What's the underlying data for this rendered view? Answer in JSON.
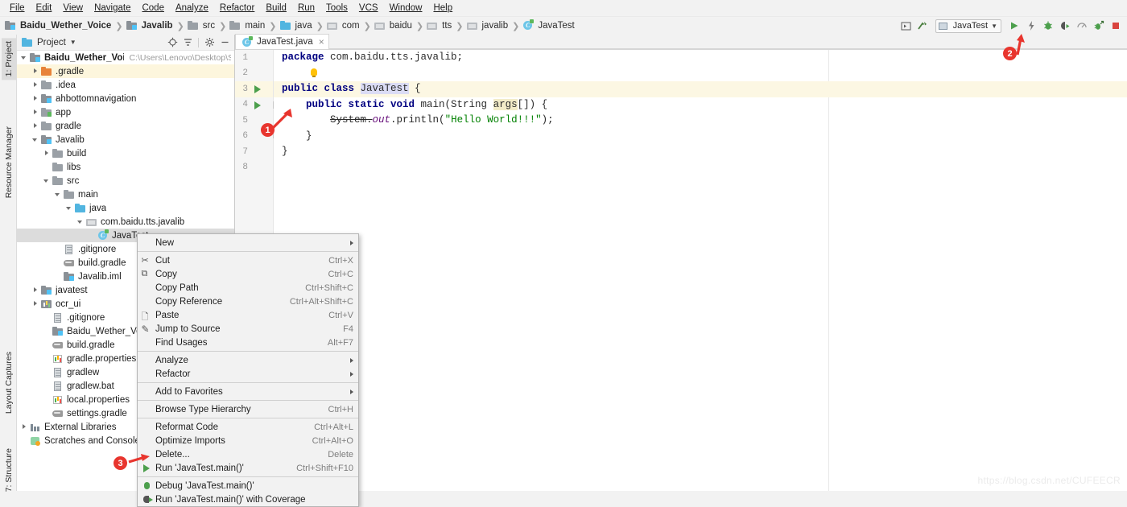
{
  "menubar": {
    "items": [
      "File",
      "Edit",
      "View",
      "Navigate",
      "Code",
      "Analyze",
      "Refactor",
      "Build",
      "Run",
      "Tools",
      "VCS",
      "Window",
      "Help"
    ]
  },
  "breadcrumb": {
    "items": [
      {
        "label": "Baidu_Wether_Voice",
        "icon": "module-icon",
        "bold": true
      },
      {
        "label": "Javalib",
        "icon": "module-icon",
        "bold": true
      },
      {
        "label": "src",
        "icon": "folder-icon",
        "bold": false
      },
      {
        "label": "main",
        "icon": "folder-icon",
        "bold": false
      },
      {
        "label": "java",
        "icon": "source-folder-icon",
        "bold": false
      },
      {
        "label": "com",
        "icon": "package-icon",
        "bold": false
      },
      {
        "label": "baidu",
        "icon": "package-icon",
        "bold": false
      },
      {
        "label": "tts",
        "icon": "package-icon",
        "bold": false
      },
      {
        "label": "javalib",
        "icon": "package-icon",
        "bold": false
      },
      {
        "label": "JavaTest",
        "icon": "java-class-icon",
        "bold": false
      }
    ]
  },
  "toolbar": {
    "preview_layout_label": "preview-layout-icon",
    "make_project_label": "make-project-icon",
    "run_config_name": "JavaTest",
    "buttons": [
      {
        "name": "run-button",
        "icon": "play-icon"
      },
      {
        "name": "apply-changes-button",
        "icon": "lightning-icon"
      },
      {
        "name": "debug-button",
        "icon": "bug-icon"
      },
      {
        "name": "run-with-coverage-button",
        "icon": "coverage-icon"
      },
      {
        "name": "profile-button",
        "icon": "gauge-icon"
      },
      {
        "name": "attach-debugger-button",
        "icon": "attach-debugger-icon"
      },
      {
        "name": "stop-button",
        "icon": "stop-icon"
      }
    ]
  },
  "toolstrip": {
    "project": "1: Project",
    "resource_manager": "Resource Manager",
    "layout_captures": "Layout Captures",
    "structure": "7: Structure"
  },
  "project_panel": {
    "title": "Project",
    "header_icons": [
      "select-opened-file-icon",
      "collapse-all-icon",
      "settings-gear-icon",
      "hide-panel-icon"
    ],
    "root_path": "C:\\Users\\Lenovo\\Desktop\\Stud",
    "tree": [
      {
        "label": "Baidu_Wether_Voice",
        "indent": 0,
        "arrow": "open",
        "icon": "module-icon",
        "bold": true,
        "path": true
      },
      {
        "label": ".gradle",
        "indent": 1,
        "arrow": "closed",
        "icon": "folder-orange-icon",
        "highlight": true
      },
      {
        "label": ".idea",
        "indent": 1,
        "arrow": "closed",
        "icon": "folder-gray-icon"
      },
      {
        "label": "ahbottomnavigation",
        "indent": 1,
        "arrow": "closed",
        "icon": "module-icon"
      },
      {
        "label": "app",
        "indent": 1,
        "arrow": "closed",
        "icon": "app-module-icon"
      },
      {
        "label": "gradle",
        "indent": 1,
        "arrow": "closed",
        "icon": "folder-gray-icon"
      },
      {
        "label": "Javalib",
        "indent": 1,
        "arrow": "open",
        "icon": "module-icon"
      },
      {
        "label": "build",
        "indent": 2,
        "arrow": "closed",
        "icon": "folder-gray-icon"
      },
      {
        "label": "libs",
        "indent": 2,
        "arrow": "none",
        "icon": "folder-gray-icon"
      },
      {
        "label": "src",
        "indent": 2,
        "arrow": "open",
        "icon": "folder-gray-icon"
      },
      {
        "label": "main",
        "indent": 3,
        "arrow": "open",
        "icon": "folder-gray-icon"
      },
      {
        "label": "java",
        "indent": 4,
        "arrow": "open",
        "icon": "source-folder-icon"
      },
      {
        "label": "com.baidu.tts.javalib",
        "indent": 5,
        "arrow": "open",
        "icon": "package-icon"
      },
      {
        "label": "JavaTest",
        "indent": 6,
        "arrow": "none",
        "icon": "java-class-icon",
        "selected": true
      },
      {
        "label": ".gitignore",
        "indent": 3,
        "arrow": "none",
        "icon": "text-file-icon"
      },
      {
        "label": "build.gradle",
        "indent": 3,
        "arrow": "none",
        "icon": "gradle-file-icon"
      },
      {
        "label": "Javalib.iml",
        "indent": 3,
        "arrow": "none",
        "icon": "module-file-icon"
      },
      {
        "label": "javatest",
        "indent": 1,
        "arrow": "closed",
        "icon": "module-icon"
      },
      {
        "label": "ocr_ui",
        "indent": 1,
        "arrow": "closed",
        "icon": "ocr-module-icon"
      },
      {
        "label": ".gitignore",
        "indent": 2,
        "arrow": "none",
        "icon": "text-file-icon"
      },
      {
        "label": "Baidu_Wether_Voice.im",
        "indent": 2,
        "arrow": "none",
        "icon": "module-file-icon"
      },
      {
        "label": "build.gradle",
        "indent": 2,
        "arrow": "none",
        "icon": "gradle-file-icon"
      },
      {
        "label": "gradle.properties",
        "indent": 2,
        "arrow": "none",
        "icon": "properties-file-icon"
      },
      {
        "label": "gradlew",
        "indent": 2,
        "arrow": "none",
        "icon": "text-file-icon"
      },
      {
        "label": "gradlew.bat",
        "indent": 2,
        "arrow": "none",
        "icon": "text-file-icon"
      },
      {
        "label": "local.properties",
        "indent": 2,
        "arrow": "none",
        "icon": "properties-file-icon"
      },
      {
        "label": "settings.gradle",
        "indent": 2,
        "arrow": "none",
        "icon": "gradle-file-icon"
      },
      {
        "label": "External Libraries",
        "indent": 0,
        "arrow": "closed",
        "icon": "library-icon"
      },
      {
        "label": "Scratches and Consoles",
        "indent": 0,
        "arrow": "none",
        "icon": "scratches-icon"
      }
    ]
  },
  "editor": {
    "tab_label": "JavaTest.java",
    "tab_icon": "java-class-icon",
    "close_glyph": "×",
    "line_numbers": [
      "1",
      "2",
      "3",
      "4",
      "5",
      "6",
      "7",
      "8"
    ],
    "code": {
      "l1_kw": "package",
      "l1_rest": " com.baidu.tts.javalib;",
      "l3_kw1": "public class ",
      "l3_name": "JavaTest",
      "l3_rest": " {",
      "l4_kw": "public static void ",
      "l4_main": "main(String ",
      "l4_args": "args",
      "l4_rest": "[]) {",
      "l5_sys": "System.",
      "l5_out": "out",
      "l5_println": ".println(",
      "l5_str": "\"Hello World!!!\"",
      "l5_end": ");",
      "l6": "}",
      "l7": "}"
    }
  },
  "context_menu": {
    "items": [
      {
        "label": "New",
        "shortcut": "",
        "submenu": true,
        "icon": "none"
      },
      {
        "separator_after": false
      },
      {
        "label": "Cut",
        "shortcut": "Ctrl+X",
        "submenu": false,
        "icon": "scissors-icon"
      },
      {
        "label": "Copy",
        "shortcut": "Ctrl+C",
        "submenu": false,
        "icon": "copy-icon"
      },
      {
        "label": "Copy Path",
        "shortcut": "Ctrl+Shift+C",
        "submenu": false,
        "icon": "none"
      },
      {
        "label": "Copy Reference",
        "shortcut": "Ctrl+Alt+Shift+C",
        "submenu": false,
        "icon": "none"
      },
      {
        "label": "Paste",
        "shortcut": "Ctrl+V",
        "submenu": false,
        "icon": "paste-icon"
      },
      {
        "label": "Jump to Source",
        "shortcut": "F4",
        "submenu": false,
        "icon": "pencil-icon"
      },
      {
        "label": "Find Usages",
        "shortcut": "Alt+F7",
        "submenu": false,
        "icon": "none"
      },
      {
        "label": "Analyze",
        "shortcut": "",
        "submenu": true,
        "icon": "none"
      },
      {
        "label": "Refactor",
        "shortcut": "",
        "submenu": true,
        "icon": "none"
      },
      {
        "label": "Add to Favorites",
        "shortcut": "",
        "submenu": true,
        "icon": "none"
      },
      {
        "label": "Browse Type Hierarchy",
        "shortcut": "Ctrl+H",
        "submenu": false,
        "icon": "none"
      },
      {
        "label": "Reformat Code",
        "shortcut": "Ctrl+Alt+L",
        "submenu": false,
        "icon": "none"
      },
      {
        "label": "Optimize Imports",
        "shortcut": "Ctrl+Alt+O",
        "submenu": false,
        "icon": "none"
      },
      {
        "label": "Delete...",
        "shortcut": "Delete",
        "submenu": false,
        "icon": "none"
      },
      {
        "label": "Run 'JavaTest.main()'",
        "shortcut": "Ctrl+Shift+F10",
        "submenu": false,
        "icon": "play-icon"
      },
      {
        "label": "Debug 'JavaTest.main()'",
        "shortcut": "",
        "submenu": false,
        "icon": "bug-icon"
      },
      {
        "label": "Run 'JavaTest.main()' with Coverage",
        "shortcut": "",
        "submenu": false,
        "icon": "coverage-icon"
      }
    ]
  },
  "annotations": [
    {
      "number": "1"
    },
    {
      "number": "2"
    },
    {
      "number": "3"
    }
  ],
  "watermark": "https://blog.csdn.net/CUFEECR",
  "colors": {
    "accent_red": "#e8352e",
    "run_green": "#4c9f4c",
    "keyword_blue": "#000080",
    "string_green": "#008000",
    "highlight_yellow": "#fcf7e3"
  }
}
